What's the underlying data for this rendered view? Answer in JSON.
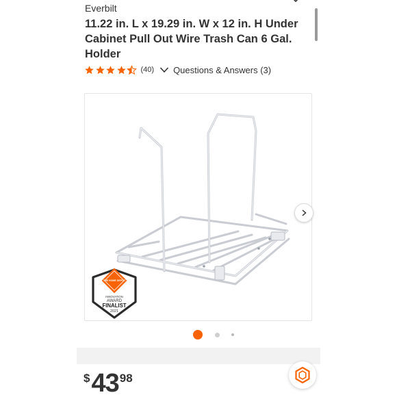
{
  "product": {
    "brand": "Everbilt",
    "title": "11.22 in. L x 19.29 in. W x 12 in. H Under Cabinet Pull Out Wire Trash Can 6 Gal. Holder",
    "rating": 4.5,
    "review_count_label": "(40)",
    "qa_label": "Questions & Answers (3)"
  },
  "gallery": {
    "badge": {
      "logo_text": "THE HOME DEPOT",
      "line1": "INNOVATION",
      "line2": "AWARD",
      "line3": "FINALIST",
      "year": "2021"
    },
    "total_images": 3,
    "active_index": 0
  },
  "price": {
    "dollar_sign": "$",
    "dollars": "43",
    "cents": "98"
  },
  "icons": {
    "collapse": "chevron-down-icon",
    "next": "chevron-right-icon",
    "qa": "chevron-down-icon",
    "pro": "hexagon-icon"
  },
  "colors": {
    "accent": "#f96302",
    "star": "#f96302",
    "text": "#333333"
  }
}
